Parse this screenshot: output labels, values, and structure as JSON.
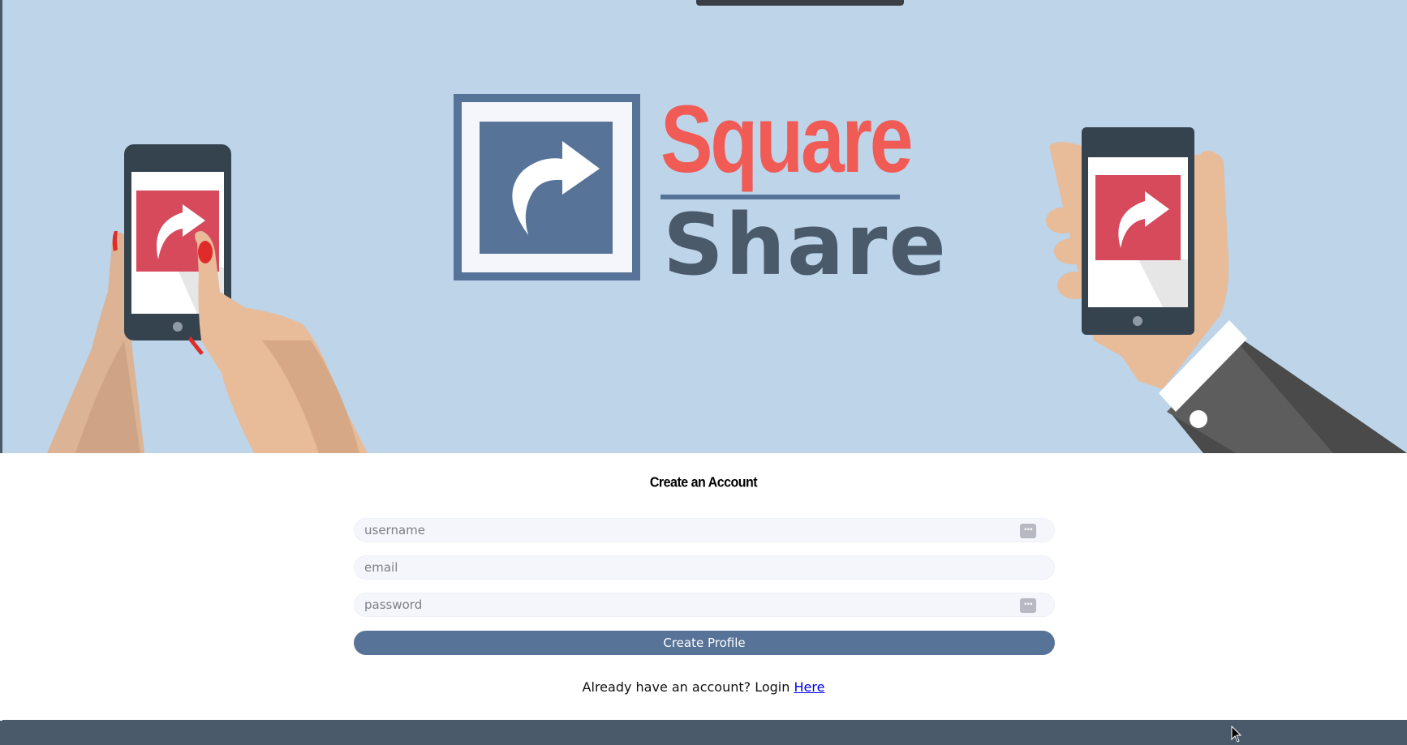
{
  "logo": {
    "word1": "Square",
    "word2": "Share"
  },
  "form": {
    "title": "Create an Account",
    "username_placeholder": "username",
    "email_placeholder": "email",
    "password_placeholder": "password",
    "submit_label": "Create Profile",
    "login_prompt": "Already have an account? Login",
    "login_link": "Here"
  },
  "icons": {
    "key": "password-manager-key-icon",
    "share": "share-arrow-icon"
  },
  "colors": {
    "hero_bg": "#bdd4e9",
    "brand_blue": "#587398",
    "brand_red": "#f15b55",
    "share_dark": "#4a5a6b",
    "footer": "#4a5a6b"
  }
}
